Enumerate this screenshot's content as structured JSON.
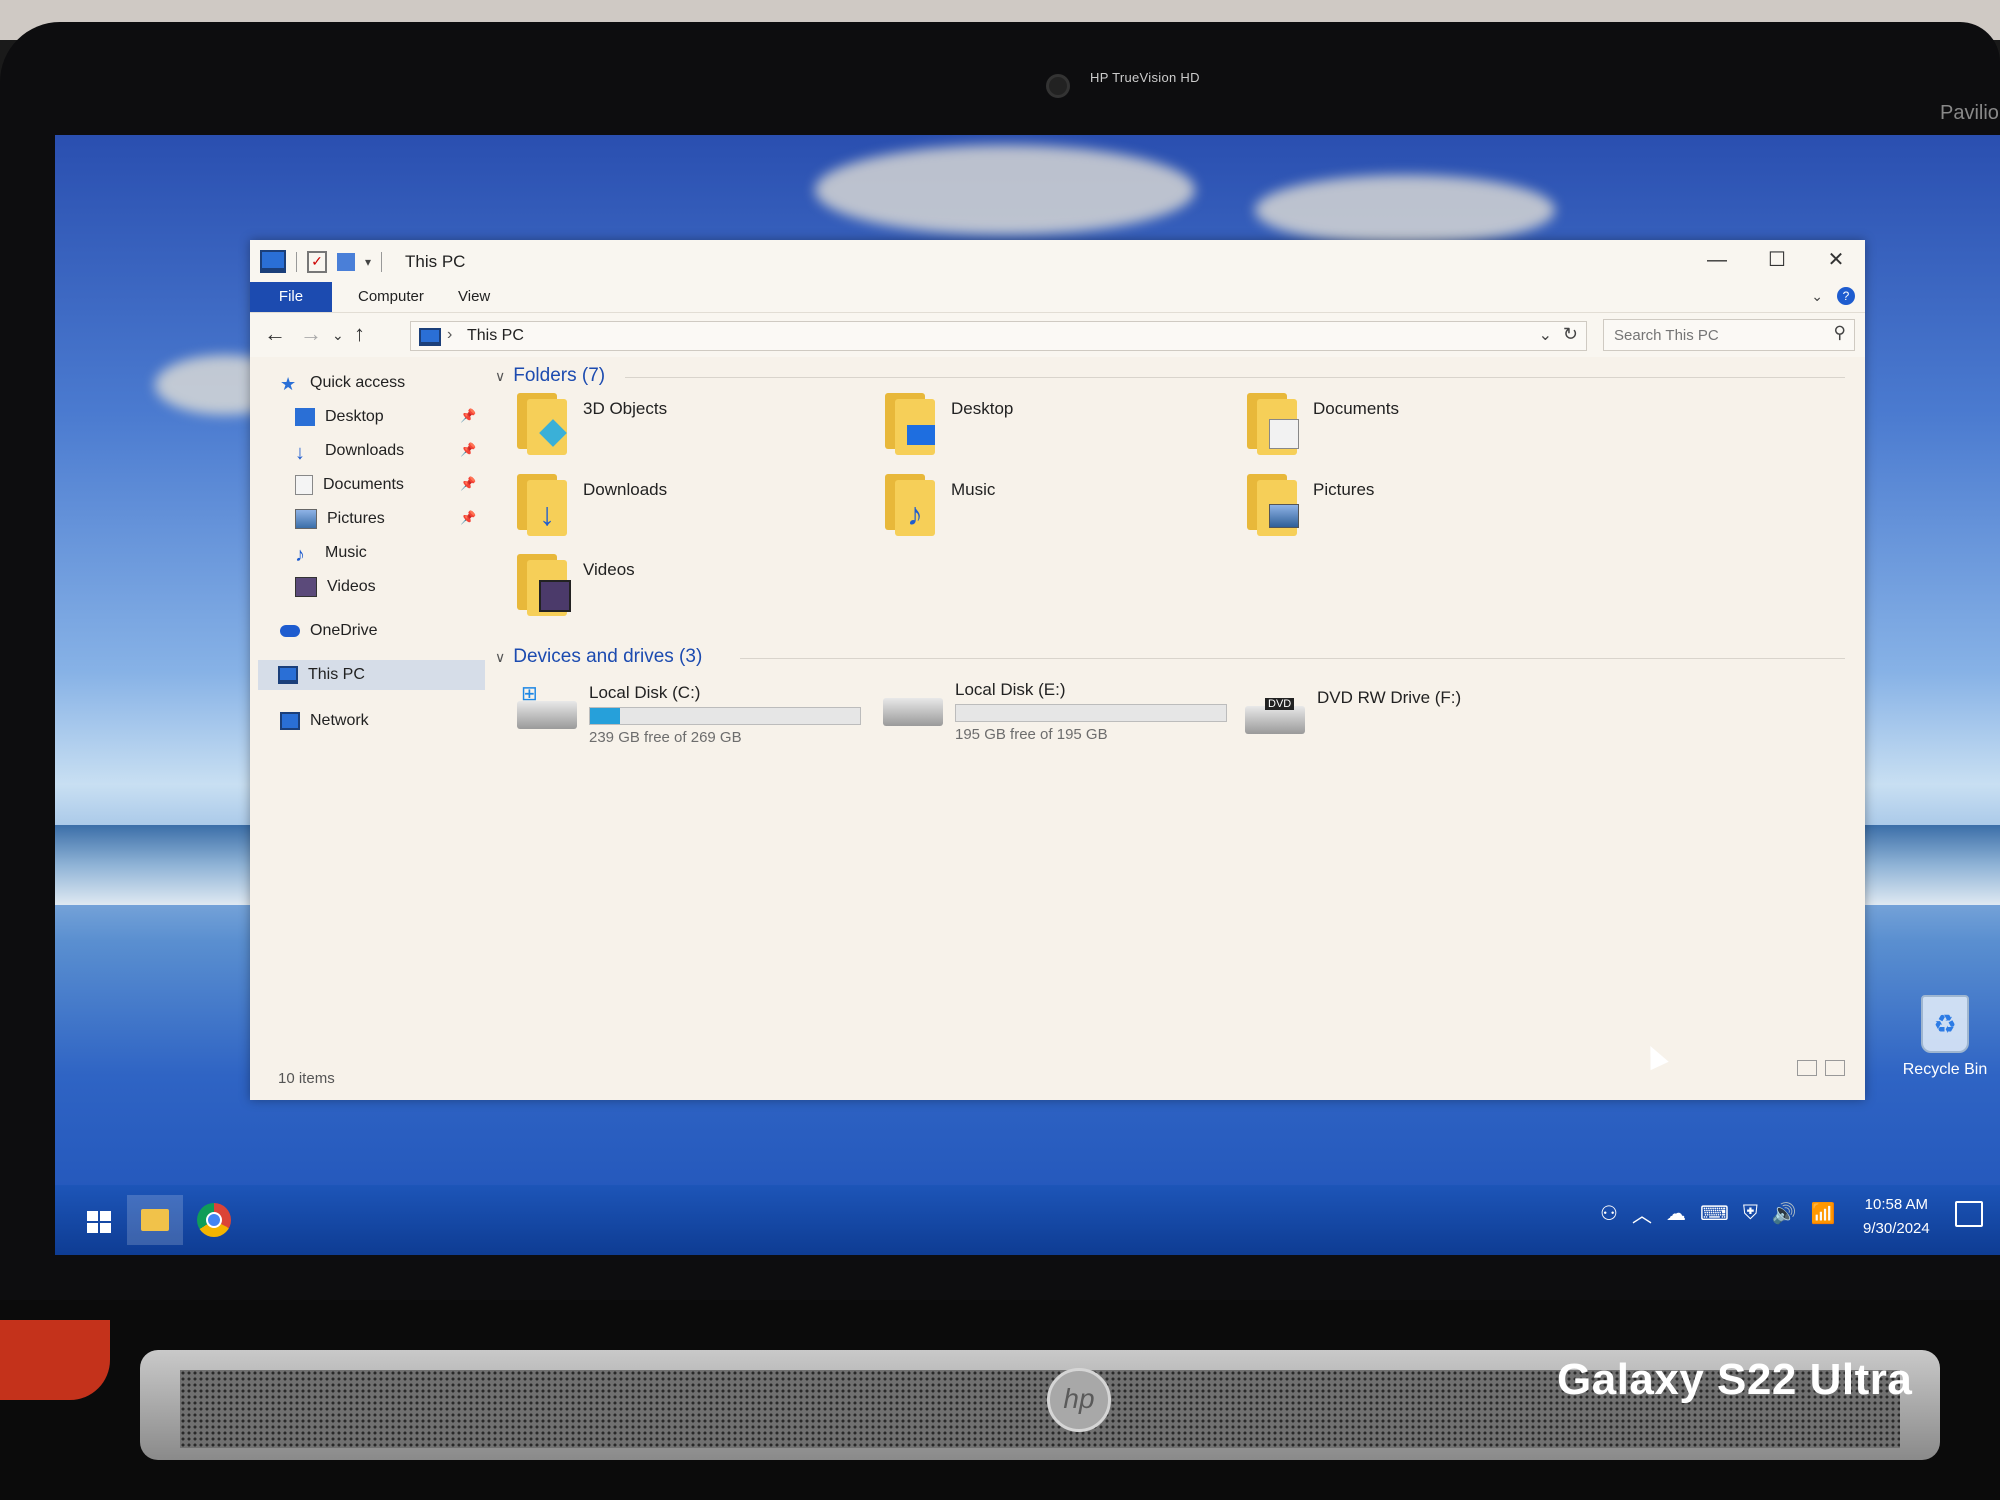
{
  "bezel": {
    "camera_label": "HP TrueVision HD",
    "brand_label": "Pavilion"
  },
  "window": {
    "title": "This PC",
    "controls": {
      "minimize": "—",
      "maximize": "☐",
      "close": "✕"
    },
    "ribbon_tabs": [
      "File",
      "Computer",
      "View"
    ],
    "address": {
      "crumb": "This PC"
    },
    "search": {
      "placeholder": "Search This PC"
    }
  },
  "navpane": {
    "quick_access": "Quick access",
    "quick_items": [
      {
        "label": "Desktop",
        "pinned": true,
        "icon": "desktop-icon"
      },
      {
        "label": "Downloads",
        "pinned": true,
        "icon": "download-icon"
      },
      {
        "label": "Documents",
        "pinned": true,
        "icon": "documents-icon"
      },
      {
        "label": "Pictures",
        "pinned": true,
        "icon": "pictures-icon"
      },
      {
        "label": "Music",
        "pinned": false,
        "icon": "music-icon"
      },
      {
        "label": "Videos",
        "pinned": false,
        "icon": "videos-icon"
      }
    ],
    "onedrive": "OneDrive",
    "this_pc": "This PC",
    "network": "Network"
  },
  "content": {
    "folders_header": "Folders (7)",
    "folders": [
      "3D Objects",
      "Desktop",
      "Documents",
      "Downloads",
      "Music",
      "Pictures",
      "Videos"
    ],
    "devices_header": "Devices and drives (3)",
    "drives": [
      {
        "name": "Local Disk (C:)",
        "free": "239 GB free of 269 GB",
        "used_fraction": 0.11
      },
      {
        "name": "Local Disk (E:)",
        "free": "195 GB free of 195 GB",
        "used_fraction": 0.0
      },
      {
        "name": "DVD RW Drive (F:)",
        "free": "",
        "badge": "DVD"
      }
    ]
  },
  "status": {
    "items": "10 items"
  },
  "desktop": {
    "recycle_bin": "Recycle Bin"
  },
  "taskbar": {
    "time": "10:58 AM",
    "date": "9/30/2024"
  },
  "watermark": "Galaxy S22 Ultra",
  "colors": {
    "accent": "#1c4bb0",
    "drive_bar": "#26a0da",
    "folder": "#f6cf58"
  }
}
